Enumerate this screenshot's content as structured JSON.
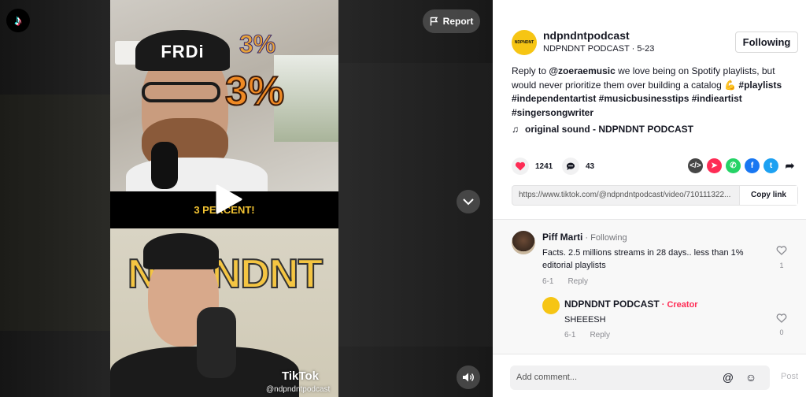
{
  "stage": {
    "report_label": "Report",
    "caption": "3 PERCENT!",
    "overlay_pct_small": "3%",
    "overlay_pct_big": "3%",
    "cap_text": "FRDi",
    "backdrop_text": "NDPNDNT",
    "watermark": "TikTok",
    "handle": "@ndpndntpodcast"
  },
  "post": {
    "avatar_text": "NDPNDNT",
    "username": "ndpndntpodcast",
    "subline": "NDPNDNT PODCAST · 5-23",
    "follow_label": "Following",
    "desc_prefix": "Reply to ",
    "desc_mention": "@zoeraemusic",
    "desc_body": " we love being on Spotify playlists, but would never prioritize them over building a catalog 💪 ",
    "hashtags": "#playlists #independentartist #musicbusinesstips #indieartist #singersongwriter",
    "sound": "original sound - NDPNDNT PODCAST",
    "likes": "1241",
    "comments": "43",
    "link_url": "https://www.tiktok.com/@ndpndntpodcast/video/710111322...",
    "copy_label": "Copy link"
  },
  "share_icons": [
    "embed-icon",
    "send-icon",
    "whatsapp-icon",
    "facebook-icon",
    "twitter-icon",
    "share-arrow-icon"
  ],
  "comments": [
    {
      "name": "Piff Marti",
      "tag": " · Following",
      "text": "Facts. 2.5 millions streams in 28 days.. less than 1% editorial playlists",
      "date": "6-1",
      "reply_label": "Reply",
      "likes": "1"
    },
    {
      "name": "NDPNDNT PODCAST",
      "tag": " · Creator",
      "text": "SHEEESH",
      "date": "6-1",
      "reply_label": "Reply",
      "likes": "0"
    }
  ],
  "composer": {
    "placeholder": "Add comment...",
    "post_label": "Post"
  },
  "colors": {
    "like_red": "#fe2c55",
    "creator_red": "#fe2c55",
    "whatsapp": "#25d366",
    "facebook": "#1877f2",
    "twitter": "#1da1f2",
    "send": "#fe2c55",
    "embed": "#464646"
  }
}
